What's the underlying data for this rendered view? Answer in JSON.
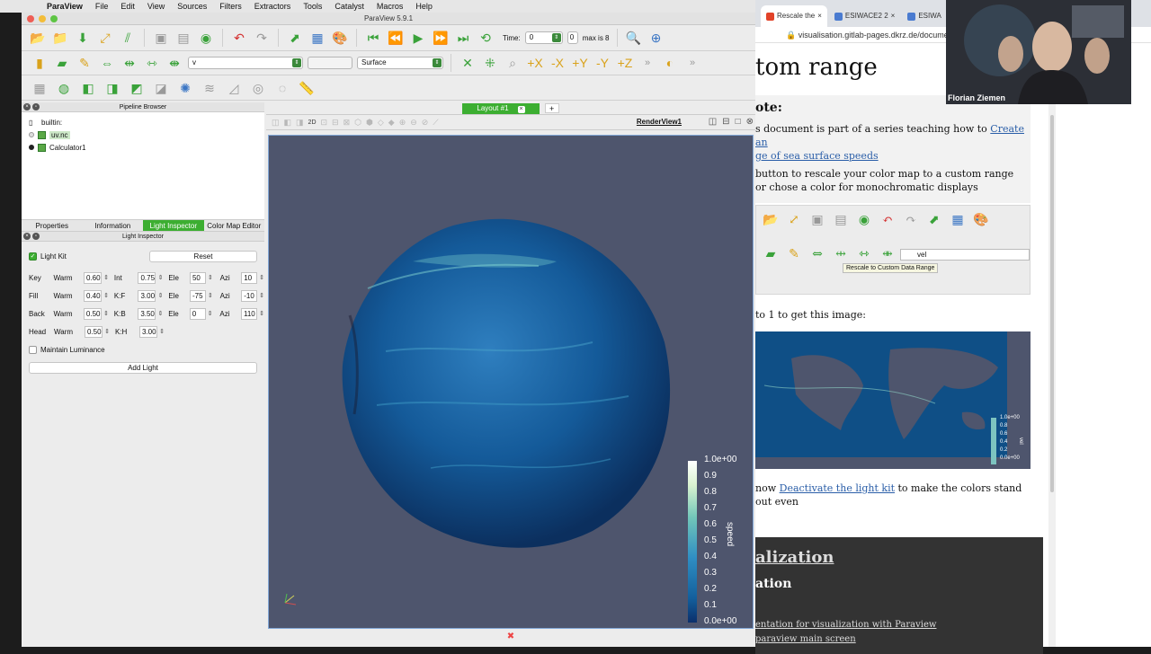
{
  "menubar": {
    "app": "ParaView",
    "items": [
      "File",
      "Edit",
      "View",
      "Sources",
      "Filters",
      "Extractors",
      "Tools",
      "Catalyst",
      "Macros",
      "Help"
    ]
  },
  "window": {
    "title": "ParaView 5.9.1"
  },
  "toolbar1": {
    "time_label": "Time:",
    "time_value": "0",
    "time_index": "0",
    "max_label": "max is 8"
  },
  "toolbar2": {
    "color_by": "v",
    "representation": "Surface"
  },
  "pipeline": {
    "header": "Pipeline Browser",
    "items": [
      "builtin:",
      "uv.nc",
      "Calculator1"
    ]
  },
  "panel_tabs": [
    "Properties",
    "Information",
    "Light Inspector",
    "Color Map Editor"
  ],
  "light_inspector": {
    "header": "Light Inspector",
    "light_kit_label": "Light Kit",
    "reset_label": "Reset",
    "rows": [
      {
        "name": "Key",
        "warm_label": "Warm",
        "warm": "0.60",
        "k_label": "Int",
        "k": "0.75",
        "ele_label": "Ele",
        "ele": "50",
        "azi_label": "Azi",
        "azi": "10"
      },
      {
        "name": "Fill",
        "warm_label": "Warm",
        "warm": "0.40",
        "k_label": "K:F",
        "k": "3.00",
        "ele_label": "Ele",
        "ele": "-75",
        "azi_label": "Azi",
        "azi": "-10"
      },
      {
        "name": "Back",
        "warm_label": "Warm",
        "warm": "0.50",
        "k_label": "K:B",
        "k": "3.50",
        "ele_label": "Ele",
        "ele": "0",
        "azi_label": "Azi",
        "azi": "110"
      },
      {
        "name": "Head",
        "warm_label": "Warm",
        "warm": "0.50",
        "k_label": "K:H",
        "k": "3.00"
      }
    ],
    "maintain_label": "Maintain Luminance",
    "add_light_label": "Add Light"
  },
  "layout": {
    "tab": "Layout #1",
    "plus": "+"
  },
  "render_view": {
    "name": "RenderView1",
    "mode_2d": "2D",
    "legend_title": "speed",
    "legend_ticks": [
      "1.0e+00",
      "0.9",
      "0.8",
      "0.7",
      "0.6",
      "0.5",
      "0.4",
      "0.3",
      "0.2",
      "0.1",
      "0.0e+00"
    ]
  },
  "browser": {
    "tabs": [
      "Rescale the",
      "ESIWACE2 2",
      "ESIWA"
    ],
    "url": "visualisation.gitlab-pages.dkrz.de/docume",
    "heading": "tom range",
    "note_title": "ote:",
    "note_p1_prefix": "s document is part of a series teaching how to ",
    "note_p1_link": "Create an",
    "note_p1_link2": "ge of sea surface speeds",
    "note_p2": " button to rescale your color map to a custom range or chose a color for monochromatic displays",
    "tooltip": "Rescale to Custom Data Range",
    "vel_field": "vel",
    "p3": " to 1 to get this image:",
    "p4_prefix": " now ",
    "p4_link": "Deactivate the light kit",
    "p4_suffix": " to make the colors stand out even",
    "dark_h1": "alization",
    "dark_h2": "ation",
    "dark_l1": "entation for visualization with Paraview",
    "dark_l2": "paraview main screen",
    "thumb_legend": [
      "1.0e+00",
      "0.8",
      "0.6",
      "0.4",
      "0.2",
      "0.0e+00"
    ],
    "thumb_label": "vel"
  },
  "webcam": {
    "name": "Florian Ziemen"
  },
  "colors": {
    "accent": "#3cae31",
    "background": "#4e556d"
  }
}
